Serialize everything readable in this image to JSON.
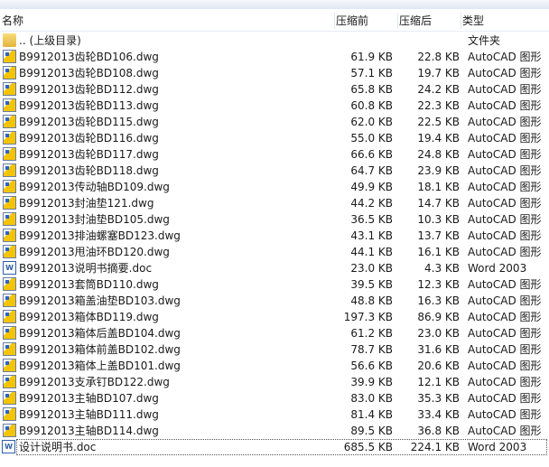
{
  "columns": {
    "name": "名称",
    "size": "压缩前",
    "packed": "压缩后",
    "type": "类型"
  },
  "parent": {
    "name": ".. (上级目录)",
    "type": "文件夹"
  },
  "files": [
    {
      "name": "B9912013齿轮BD106.dwg",
      "size": "61.9 KB",
      "packed": "22.8 KB",
      "type": "AutoCAD 图形",
      "icon": "dwg"
    },
    {
      "name": "B9912013齿轮BD108.dwg",
      "size": "57.1 KB",
      "packed": "19.7 KB",
      "type": "AutoCAD 图形",
      "icon": "dwg"
    },
    {
      "name": "B9912013齿轮BD112.dwg",
      "size": "65.8 KB",
      "packed": "24.2 KB",
      "type": "AutoCAD 图形",
      "icon": "dwg"
    },
    {
      "name": "B9912013齿轮BD113.dwg",
      "size": "60.8 KB",
      "packed": "22.3 KB",
      "type": "AutoCAD 图形",
      "icon": "dwg"
    },
    {
      "name": "B9912013齿轮BD115.dwg",
      "size": "62.0 KB",
      "packed": "22.5 KB",
      "type": "AutoCAD 图形",
      "icon": "dwg"
    },
    {
      "name": "B9912013齿轮BD116.dwg",
      "size": "55.0 KB",
      "packed": "19.4 KB",
      "type": "AutoCAD 图形",
      "icon": "dwg"
    },
    {
      "name": "B9912013齿轮BD117.dwg",
      "size": "66.6 KB",
      "packed": "24.8 KB",
      "type": "AutoCAD 图形",
      "icon": "dwg"
    },
    {
      "name": "B9912013齿轮BD118.dwg",
      "size": "64.7 KB",
      "packed": "23.9 KB",
      "type": "AutoCAD 图形",
      "icon": "dwg"
    },
    {
      "name": "B9912013传动轴BD109.dwg",
      "size": "49.9 KB",
      "packed": "18.1 KB",
      "type": "AutoCAD 图形",
      "icon": "dwg"
    },
    {
      "name": "B9912013封油垫121.dwg",
      "size": "44.2 KB",
      "packed": "14.7 KB",
      "type": "AutoCAD 图形",
      "icon": "dwg"
    },
    {
      "name": "B9912013封油垫BD105.dwg",
      "size": "36.5 KB",
      "packed": "10.3 KB",
      "type": "AutoCAD 图形",
      "icon": "dwg"
    },
    {
      "name": "B9912013排油螺塞BD123.dwg",
      "size": "43.1 KB",
      "packed": "13.7 KB",
      "type": "AutoCAD 图形",
      "icon": "dwg"
    },
    {
      "name": "B9912013甩油环BD120.dwg",
      "size": "44.1 KB",
      "packed": "16.1 KB",
      "type": "AutoCAD 图形",
      "icon": "dwg"
    },
    {
      "name": "B9912013说明书摘要.doc",
      "size": "23.0 KB",
      "packed": "4.3 KB",
      "type": "Word 2003",
      "icon": "doc"
    },
    {
      "name": "B9912013套筒BD110.dwg",
      "size": "39.5 KB",
      "packed": "12.3 KB",
      "type": "AutoCAD 图形",
      "icon": "dwg"
    },
    {
      "name": "B9912013箱盖油垫BD103.dwg",
      "size": "48.8 KB",
      "packed": "16.3 KB",
      "type": "AutoCAD 图形",
      "icon": "dwg"
    },
    {
      "name": "B9912013箱体BD119.dwg",
      "size": "197.3 KB",
      "packed": "86.9 KB",
      "type": "AutoCAD 图形",
      "icon": "dwg"
    },
    {
      "name": "B9912013箱体后盖BD104.dwg",
      "size": "61.2 KB",
      "packed": "23.0 KB",
      "type": "AutoCAD 图形",
      "icon": "dwg"
    },
    {
      "name": "B9912013箱体前盖BD102.dwg",
      "size": "78.7 KB",
      "packed": "31.6 KB",
      "type": "AutoCAD 图形",
      "icon": "dwg"
    },
    {
      "name": "B9912013箱体上盖BD101.dwg",
      "size": "56.6 KB",
      "packed": "20.6 KB",
      "type": "AutoCAD 图形",
      "icon": "dwg"
    },
    {
      "name": "B9912013支承钉BD122.dwg",
      "size": "39.9 KB",
      "packed": "12.1 KB",
      "type": "AutoCAD 图形",
      "icon": "dwg"
    },
    {
      "name": "B9912013主轴BD107.dwg",
      "size": "83.0 KB",
      "packed": "35.3 KB",
      "type": "AutoCAD 图形",
      "icon": "dwg"
    },
    {
      "name": "B9912013主轴BD111.dwg",
      "size": "81.4 KB",
      "packed": "33.4 KB",
      "type": "AutoCAD 图形",
      "icon": "dwg"
    },
    {
      "name": "B9912013主轴BD114.dwg",
      "size": "89.5 KB",
      "packed": "36.8 KB",
      "type": "AutoCAD 图形",
      "icon": "dwg"
    },
    {
      "name": "设计说明书.doc",
      "size": "685.5 KB",
      "packed": "224.1 KB",
      "type": "Word 2003",
      "icon": "doc"
    }
  ]
}
